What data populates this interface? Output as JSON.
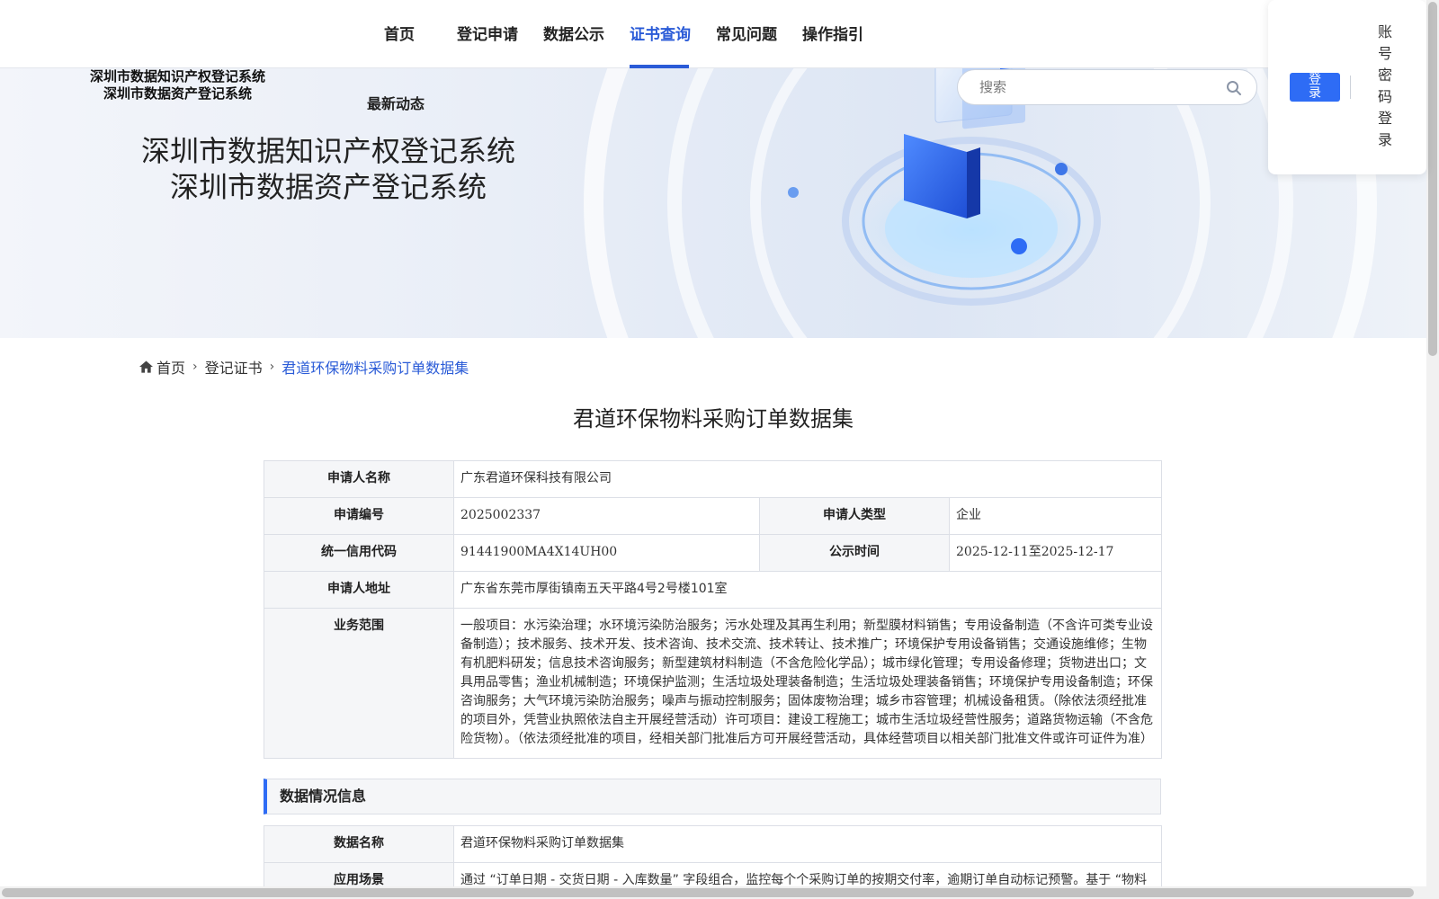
{
  "nav": {
    "items": [
      {
        "label": "首页",
        "active": false
      },
      {
        "label": "登记申请",
        "active": false
      },
      {
        "label": "数据公示",
        "active": false
      },
      {
        "label": "证书查询",
        "active": true
      },
      {
        "label": "常见问题",
        "active": false
      },
      {
        "label": "操作指引",
        "active": false
      }
    ],
    "accent_color": "#2a5bd7"
  },
  "header": {
    "system_name_line1": "深圳市数据知识产权登记系统",
    "system_name_line2": "深圳市数据资产登记系统",
    "news_link": "最新动态"
  },
  "banner": {
    "title_line1": "深圳市数据知识产权登记系统",
    "title_line2": "深圳市数据资产登记系统"
  },
  "search": {
    "placeholder": "搜索",
    "icon": "search-icon"
  },
  "login": {
    "login_button": "登录",
    "password_login": "账号密码登录",
    "button_color": "#2e6cf5"
  },
  "breadcrumb": {
    "home": "首页",
    "level2": "登记证书",
    "current": "君道环保物料采购订单数据集",
    "home_icon": "home-icon",
    "separator_icon": "chevron-right-icon"
  },
  "page_title": "君道环保物料采购订单数据集",
  "applicant": {
    "name_label": "申请人名称",
    "name_value": "广东君道环保科技有限公司",
    "number_label": "申请编号",
    "number_value": "2025002337",
    "type_label": "申请人类型",
    "type_value": "企业",
    "credit_label": "统一信用代码",
    "credit_value": "91441900MA4X14UH00",
    "publicity_label": "公示时间",
    "publicity_value": "2025-12-11至2025-12-17",
    "address_label": "申请人地址",
    "address_value": "广东省东莞市厚街镇南五天平路4号2号楼101室",
    "scope_label": "业务范围",
    "scope_value": "一般项目：水污染治理；水环境污染防治服务；污水处理及其再生利用；新型膜材料销售；专用设备制造（不含许可类专业设备制造）；技术服务、技术开发、技术咨询、技术交流、技术转让、技术推广；环境保护专用设备销售；交通设施维修；生物有机肥料研发；信息技术咨询服务；新型建筑材料制造（不含危险化学品）；城市绿化管理；专用设备修理；货物进出口；文具用品零售；渔业机械制造；环境保护监测；生活垃圾处理装备制造；生活垃圾处理装备销售；环境保护专用设备制造；环保咨询服务；大气环境污染防治服务；噪声与振动控制服务；固体废物治理；城乡市容管理；机械设备租赁。（除依法须经批准的项目外，凭营业执照依法自主开展经营活动）许可项目：建设工程施工；城市生活垃圾经营性服务；道路货物运输（不含危险货物）。（依法须经批准的项目，经相关部门批准后方可开展经营活动，具体经营项目以相关部门批准文件或许可证件为准）"
  },
  "data_section": {
    "heading": "数据情况信息",
    "name_label": "数据名称",
    "name_value": "君道环保物料采购订单数据集",
    "scene_label": "应用场景",
    "scene_value": "通过 “订单日期 - 交货日期 - 入库数量” 字段组合，监控每个个采购订单的按期交付率，逾期订单自动标记预警。基于 “物料代码 - 规格型号 - 入库数量” 关联，按时间序列分析采购量与项目需求的匹配度，避免物料积压或短缺，结合“供应商代码 - 订单数量 - 交"
  }
}
